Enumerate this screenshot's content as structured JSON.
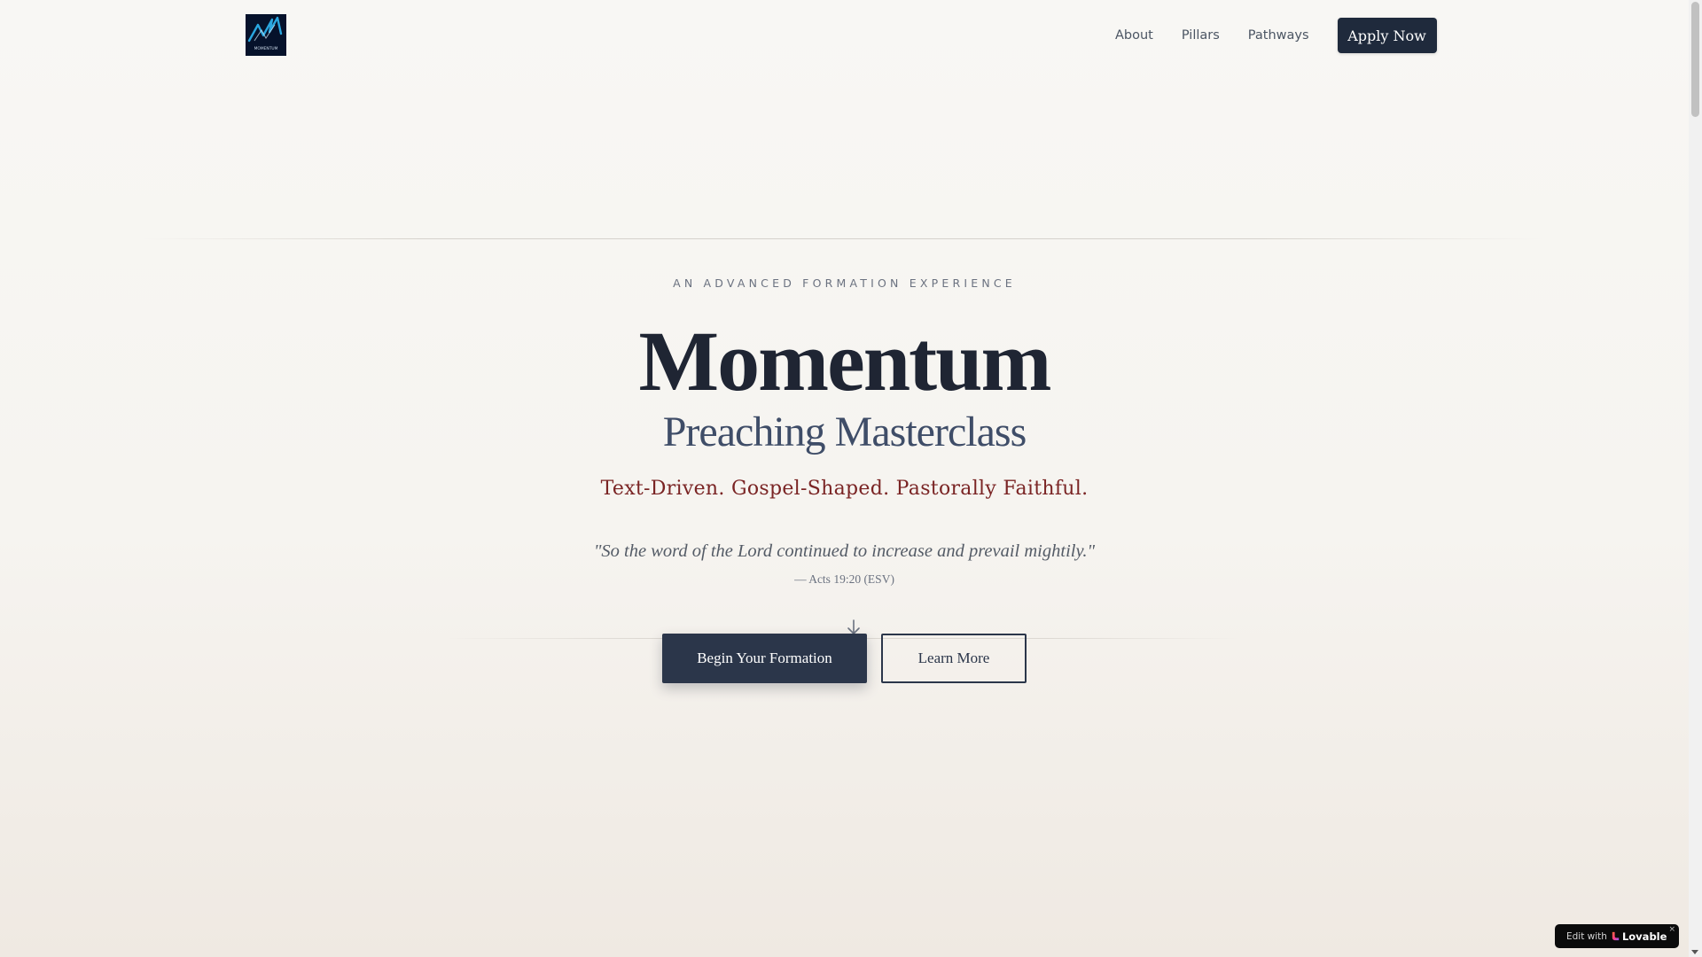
{
  "header": {
    "logo_icon": "momentum-logo-icon",
    "logo_text": "MOMENTUM",
    "nav": [
      {
        "label": "About"
      },
      {
        "label": "Pillars"
      },
      {
        "label": "Pathways"
      }
    ],
    "apply_label": "Apply Now"
  },
  "hero": {
    "eyebrow": "AN ADVANCED FORMATION EXPERIENCE",
    "title": "Momentum",
    "subtitle": "Preaching Masterclass",
    "tagline": "Text-Driven. Gospel-Shaped. Pastorally Faithful.",
    "quote": "\"So the word of the Lord continued to increase and prevail mightily.\"",
    "citation": "— Acts 19:20 (ESV)",
    "scroll_icon": "arrow-down-icon",
    "primary_cta": "Begin Your Formation",
    "secondary_cta": "Learn More"
  },
  "badge": {
    "edit_text": "Edit with",
    "brand": "Lovable",
    "close": "×"
  },
  "colors": {
    "navy": "#1f2a3c",
    "accent_red": "#7a2424",
    "subtitle_blue": "#3f4d68",
    "background": "#f7f6f3"
  }
}
